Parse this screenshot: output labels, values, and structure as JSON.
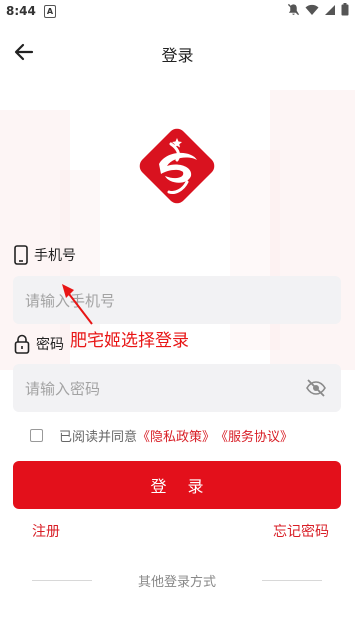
{
  "status_bar": {
    "time": "8:44",
    "notif_letter": "A"
  },
  "header": {
    "title": "登录"
  },
  "phone": {
    "label": "手机号",
    "placeholder": "请输入手机号"
  },
  "password": {
    "label": "密码",
    "placeholder": "请输入密码"
  },
  "annotation": "肥宅姬选择登录",
  "agreement": {
    "prefix": "已阅读并同意",
    "privacy": "《隐私政策》",
    "service": "《服务协议》"
  },
  "login_button": "登 录",
  "register": "注册",
  "forgot_password": "忘记密码",
  "other_login": "其他登录方式",
  "colors": {
    "accent": "#e3101b",
    "link": "#d81e26",
    "input_bg": "#f2f2f4"
  }
}
